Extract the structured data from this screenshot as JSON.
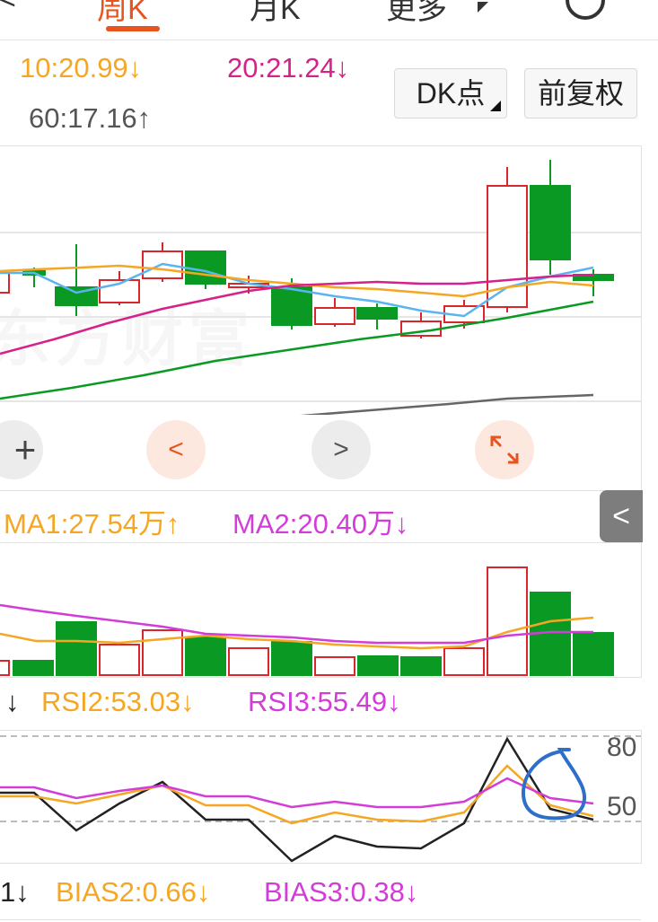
{
  "tabs": {
    "partial_left": "<",
    "weekly": "周K",
    "monthly": "月K",
    "more": "更多"
  },
  "ma": {
    "ma10": "10:20.99↓",
    "ma20": "20:21.24↓",
    "ma60": "60:17.16↑",
    "colors": {
      "ma10": "#f5a623",
      "ma20": "#d6218a",
      "ma60": "#555555"
    }
  },
  "buttons": {
    "dk": "DK点",
    "fq": "前复权"
  },
  "watermark": "东方财富",
  "volume": {
    "ma1": "MA1:27.54万↑",
    "ma2": "MA2:20.40万↓"
  },
  "rsi": {
    "rsi1_fragment": "↓",
    "rsi2": "RSI2:53.03↓",
    "rsi3": "RSI3:55.49↓",
    "level_80": "80",
    "level_50": "50"
  },
  "bias": {
    "bias1_fragment": "1↓",
    "bias2": "BIAS2:0.66↓",
    "bias3": "BIAS3:0.38↓"
  },
  "colors": {
    "up": "#d7262c",
    "down": "#0a9a24",
    "orange": "#f5a623",
    "magenta": "#d23cd8",
    "blue": "#5ab4f0",
    "gray": "#666666",
    "accent": "#e8541e"
  }
}
